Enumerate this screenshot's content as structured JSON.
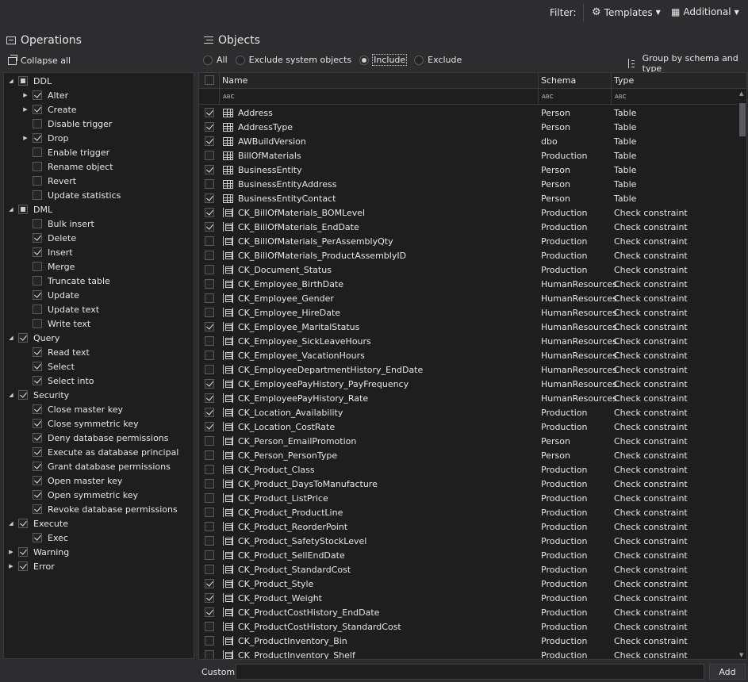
{
  "topbar": {
    "filter_label": "Filter:",
    "templates_label": "Templates",
    "additional_label": "Additional"
  },
  "operations": {
    "title": "Operations",
    "collapse_all": "Collapse all",
    "tree": [
      {
        "label": "DDL",
        "level": 0,
        "state": "partial",
        "expand": "open"
      },
      {
        "label": "Alter",
        "level": 1,
        "state": "checked",
        "expand": "closed"
      },
      {
        "label": "Create",
        "level": 1,
        "state": "checked",
        "expand": "closed"
      },
      {
        "label": "Disable trigger",
        "level": 1,
        "state": "unchecked",
        "expand": "none"
      },
      {
        "label": "Drop",
        "level": 1,
        "state": "checked",
        "expand": "closed"
      },
      {
        "label": "Enable trigger",
        "level": 1,
        "state": "unchecked",
        "expand": "none"
      },
      {
        "label": "Rename object",
        "level": 1,
        "state": "unchecked",
        "expand": "none"
      },
      {
        "label": "Revert",
        "level": 1,
        "state": "unchecked",
        "expand": "none"
      },
      {
        "label": "Update statistics",
        "level": 1,
        "state": "unchecked",
        "expand": "none"
      },
      {
        "label": "DML",
        "level": 0,
        "state": "partial",
        "expand": "open"
      },
      {
        "label": "Bulk insert",
        "level": 1,
        "state": "unchecked",
        "expand": "none"
      },
      {
        "label": "Delete",
        "level": 1,
        "state": "checked",
        "expand": "none"
      },
      {
        "label": "Insert",
        "level": 1,
        "state": "checked",
        "expand": "none"
      },
      {
        "label": "Merge",
        "level": 1,
        "state": "unchecked",
        "expand": "none"
      },
      {
        "label": "Truncate table",
        "level": 1,
        "state": "unchecked",
        "expand": "none"
      },
      {
        "label": "Update",
        "level": 1,
        "state": "checked",
        "expand": "none"
      },
      {
        "label": "Update text",
        "level": 1,
        "state": "unchecked",
        "expand": "none"
      },
      {
        "label": "Write text",
        "level": 1,
        "state": "unchecked",
        "expand": "none"
      },
      {
        "label": "Query",
        "level": 0,
        "state": "checked",
        "expand": "open"
      },
      {
        "label": "Read text",
        "level": 1,
        "state": "checked",
        "expand": "none"
      },
      {
        "label": "Select",
        "level": 1,
        "state": "checked",
        "expand": "none"
      },
      {
        "label": "Select into",
        "level": 1,
        "state": "checked",
        "expand": "none"
      },
      {
        "label": "Security",
        "level": 0,
        "state": "checked",
        "expand": "open"
      },
      {
        "label": "Close master key",
        "level": 1,
        "state": "checked",
        "expand": "none"
      },
      {
        "label": "Close symmetric key",
        "level": 1,
        "state": "checked",
        "expand": "none"
      },
      {
        "label": "Deny database permissions",
        "level": 1,
        "state": "checked",
        "expand": "none"
      },
      {
        "label": "Execute as database principal",
        "level": 1,
        "state": "checked",
        "expand": "none"
      },
      {
        "label": "Grant database permissions",
        "level": 1,
        "state": "checked",
        "expand": "none"
      },
      {
        "label": "Open master key",
        "level": 1,
        "state": "checked",
        "expand": "none"
      },
      {
        "label": "Open symmetric key",
        "level": 1,
        "state": "checked",
        "expand": "none"
      },
      {
        "label": "Revoke database permissions",
        "level": 1,
        "state": "checked",
        "expand": "none"
      },
      {
        "label": "Execute",
        "level": 0,
        "state": "checked",
        "expand": "open"
      },
      {
        "label": "Exec",
        "level": 1,
        "state": "checked",
        "expand": "none"
      },
      {
        "label": "Warning",
        "level": 0,
        "state": "checked",
        "expand": "closed"
      },
      {
        "label": "Error",
        "level": 0,
        "state": "checked",
        "expand": "closed"
      }
    ]
  },
  "objects": {
    "title": "Objects",
    "radio_options": [
      {
        "label": "All",
        "selected": false
      },
      {
        "label": "Exclude system objects",
        "selected": false
      },
      {
        "label": "Include",
        "selected": true
      },
      {
        "label": "Exclude",
        "selected": false
      }
    ],
    "group_by_label": "Group by schema and type",
    "columns": {
      "name": "Name",
      "schema": "Schema",
      "type": "Type"
    },
    "rows": [
      {
        "checked": true,
        "icon": "table",
        "name": "Address",
        "schema": "Person",
        "type": "Table"
      },
      {
        "checked": true,
        "icon": "table",
        "name": "AddressType",
        "schema": "Person",
        "type": "Table"
      },
      {
        "checked": true,
        "icon": "table",
        "name": "AWBuildVersion",
        "schema": "dbo",
        "type": "Table"
      },
      {
        "checked": false,
        "icon": "table",
        "name": "BillOfMaterials",
        "schema": "Production",
        "type": "Table"
      },
      {
        "checked": true,
        "icon": "table",
        "name": "BusinessEntity",
        "schema": "Person",
        "type": "Table"
      },
      {
        "checked": false,
        "icon": "table",
        "name": "BusinessEntityAddress",
        "schema": "Person",
        "type": "Table"
      },
      {
        "checked": true,
        "icon": "table",
        "name": "BusinessEntityContact",
        "schema": "Person",
        "type": "Table"
      },
      {
        "checked": true,
        "icon": "check",
        "name": "CK_BillOfMaterials_BOMLevel",
        "schema": "Production",
        "type": "Check constraint"
      },
      {
        "checked": true,
        "icon": "check",
        "name": "CK_BillOfMaterials_EndDate",
        "schema": "Production",
        "type": "Check constraint"
      },
      {
        "checked": false,
        "icon": "check",
        "name": "CK_BillOfMaterials_PerAssemblyQty",
        "schema": "Production",
        "type": "Check constraint"
      },
      {
        "checked": false,
        "icon": "check",
        "name": "CK_BillOfMaterials_ProductAssemblyID",
        "schema": "Production",
        "type": "Check constraint"
      },
      {
        "checked": false,
        "icon": "check",
        "name": "CK_Document_Status",
        "schema": "Production",
        "type": "Check constraint"
      },
      {
        "checked": false,
        "icon": "check",
        "name": "CK_Employee_BirthDate",
        "schema": "HumanResources",
        "type": "Check constraint"
      },
      {
        "checked": false,
        "icon": "check",
        "name": "CK_Employee_Gender",
        "schema": "HumanResources",
        "type": "Check constraint"
      },
      {
        "checked": false,
        "icon": "check",
        "name": "CK_Employee_HireDate",
        "schema": "HumanResources",
        "type": "Check constraint"
      },
      {
        "checked": true,
        "icon": "check",
        "name": "CK_Employee_MaritalStatus",
        "schema": "HumanResources",
        "type": "Check constraint"
      },
      {
        "checked": false,
        "icon": "check",
        "name": "CK_Employee_SickLeaveHours",
        "schema": "HumanResources",
        "type": "Check constraint"
      },
      {
        "checked": false,
        "icon": "check",
        "name": "CK_Employee_VacationHours",
        "schema": "HumanResources",
        "type": "Check constraint"
      },
      {
        "checked": false,
        "icon": "check",
        "name": "CK_EmployeeDepartmentHistory_EndDate",
        "schema": "HumanResources",
        "type": "Check constraint"
      },
      {
        "checked": true,
        "icon": "check",
        "name": "CK_EmployeePayHistory_PayFrequency",
        "schema": "HumanResources",
        "type": "Check constraint"
      },
      {
        "checked": true,
        "icon": "check",
        "name": "CK_EmployeePayHistory_Rate",
        "schema": "HumanResources",
        "type": "Check constraint"
      },
      {
        "checked": true,
        "icon": "check",
        "name": "CK_Location_Availability",
        "schema": "Production",
        "type": "Check constraint"
      },
      {
        "checked": true,
        "icon": "check",
        "name": "CK_Location_CostRate",
        "schema": "Production",
        "type": "Check constraint"
      },
      {
        "checked": false,
        "icon": "check",
        "name": "CK_Person_EmailPromotion",
        "schema": "Person",
        "type": "Check constraint"
      },
      {
        "checked": false,
        "icon": "check",
        "name": "CK_Person_PersonType",
        "schema": "Person",
        "type": "Check constraint"
      },
      {
        "checked": false,
        "icon": "check",
        "name": "CK_Product_Class",
        "schema": "Production",
        "type": "Check constraint"
      },
      {
        "checked": false,
        "icon": "check",
        "name": "CK_Product_DaysToManufacture",
        "schema": "Production",
        "type": "Check constraint"
      },
      {
        "checked": false,
        "icon": "check",
        "name": "CK_Product_ListPrice",
        "schema": "Production",
        "type": "Check constraint"
      },
      {
        "checked": false,
        "icon": "check",
        "name": "CK_Product_ProductLine",
        "schema": "Production",
        "type": "Check constraint"
      },
      {
        "checked": false,
        "icon": "check",
        "name": "CK_Product_ReorderPoint",
        "schema": "Production",
        "type": "Check constraint"
      },
      {
        "checked": false,
        "icon": "check",
        "name": "CK_Product_SafetyStockLevel",
        "schema": "Production",
        "type": "Check constraint"
      },
      {
        "checked": false,
        "icon": "check",
        "name": "CK_Product_SellEndDate",
        "schema": "Production",
        "type": "Check constraint"
      },
      {
        "checked": false,
        "icon": "check",
        "name": "CK_Product_StandardCost",
        "schema": "Production",
        "type": "Check constraint"
      },
      {
        "checked": true,
        "icon": "check",
        "name": "CK_Product_Style",
        "schema": "Production",
        "type": "Check constraint"
      },
      {
        "checked": true,
        "icon": "check",
        "name": "CK_Product_Weight",
        "schema": "Production",
        "type": "Check constraint"
      },
      {
        "checked": true,
        "icon": "check",
        "name": "CK_ProductCostHistory_EndDate",
        "schema": "Production",
        "type": "Check constraint"
      },
      {
        "checked": false,
        "icon": "check",
        "name": "CK_ProductCostHistory_StandardCost",
        "schema": "Production",
        "type": "Check constraint"
      },
      {
        "checked": false,
        "icon": "check",
        "name": "CK_ProductInventory_Bin",
        "schema": "Production",
        "type": "Check constraint"
      },
      {
        "checked": false,
        "icon": "check",
        "name": "CK_ProductInventory_Shelf",
        "schema": "Production",
        "type": "Check constraint"
      }
    ]
  },
  "custom": {
    "label": "Custom:",
    "value": "",
    "add_label": "Add"
  }
}
